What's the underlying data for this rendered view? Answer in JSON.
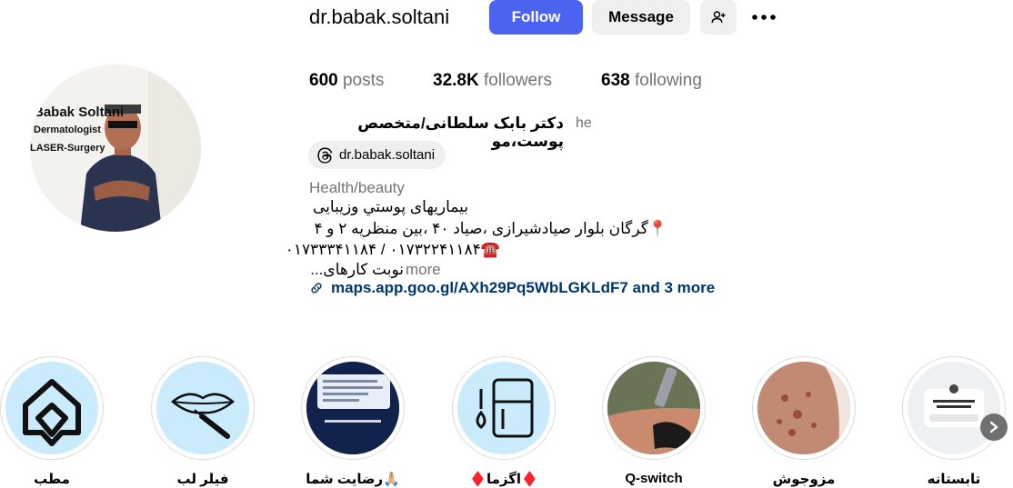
{
  "profile": {
    "username": "dr.babak.soltani",
    "full_name": "دکتر بابک سلطانی/متخصص پوست،مو",
    "pronoun": "he",
    "threads_handle": "dr.babak.soltani",
    "category": "Health/beauty",
    "bio_lines": [
      "بیماریهای پوستي وزيبايى",
      "📍گرگان بلوار صیادشیرازی ،صیاد ۴۰ ،بین منظریه ۲ و ۴",
      "☎️۰۱۷۳۲۲۴۱۱۸۴ / ۰۱۷۳۳۳۴۱۱۸۴",
      "نوبت کارهای..."
    ],
    "more_label": "more",
    "link_text": "maps.app.goo.gl/AXh29Pq5WbLGKLdF7 and 3 more",
    "avatar_text": [
      "Babak Soltani",
      "Dermatologist",
      "LASER-Surgery"
    ]
  },
  "actions": {
    "follow": "Follow",
    "message": "Message",
    "add_user_icon": "add-user-icon",
    "more_icon": "more-options-icon"
  },
  "stats": {
    "posts_count": "600",
    "posts_label": "posts",
    "followers_count": "32.8K",
    "followers_label": "followers",
    "following_count": "638",
    "following_label": "following"
  },
  "highlights": [
    {
      "label": "مطب"
    },
    {
      "label": "فیلر لب"
    },
    {
      "label": "رضایت شما🙏🏼"
    },
    {
      "label": "♦️اگزما♦️"
    },
    {
      "label": "Q-switch"
    },
    {
      "label": "مزوجوش"
    },
    {
      "label": "تابستانه"
    }
  ],
  "colors": {
    "follow_button": "#4b63f0",
    "secondary_button": "#efefef",
    "link": "#00376b",
    "muted_text": "#737373",
    "highlight_bg": "#c9ebfb"
  }
}
